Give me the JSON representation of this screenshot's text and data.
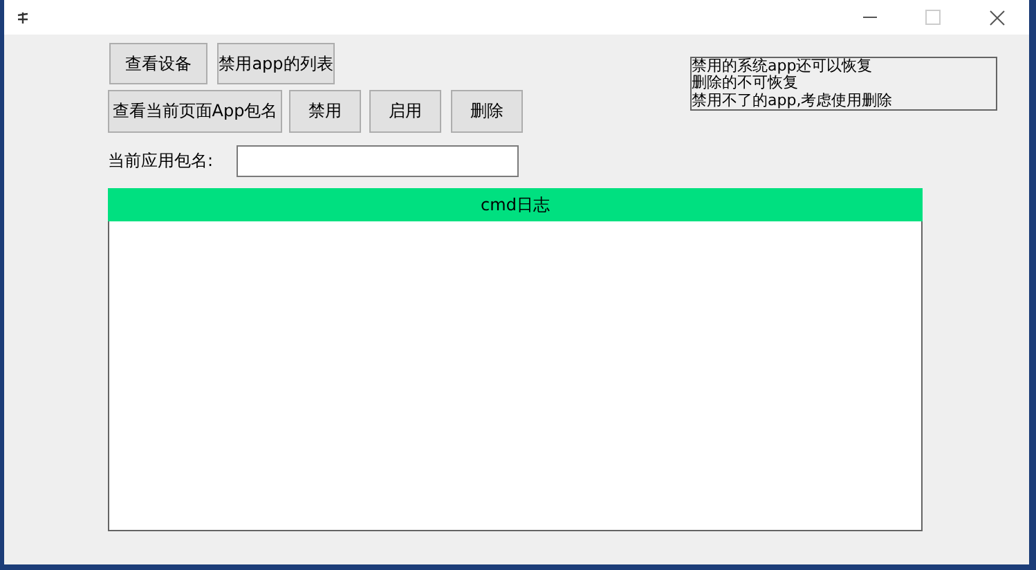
{
  "window": {
    "buttons": [
      {
        "kind": "minimize"
      },
      {
        "kind": "maximize",
        "disabled": true
      },
      {
        "kind": "close"
      }
    ]
  },
  "toolbar": {
    "row_1": [
      "查看设备",
      "禁用app的列表"
    ],
    "row_2": [
      "查看当前页面App包名",
      "禁用",
      "启用",
      "删除"
    ]
  },
  "package_field": {
    "label": "当前应用包名:"
  },
  "notes": [
    "禁用的系统app还可以恢复",
    "删除的不可恢复",
    "禁用不了的app,考虑使用删除"
  ],
  "log": {
    "title": "cmd日志"
  }
}
